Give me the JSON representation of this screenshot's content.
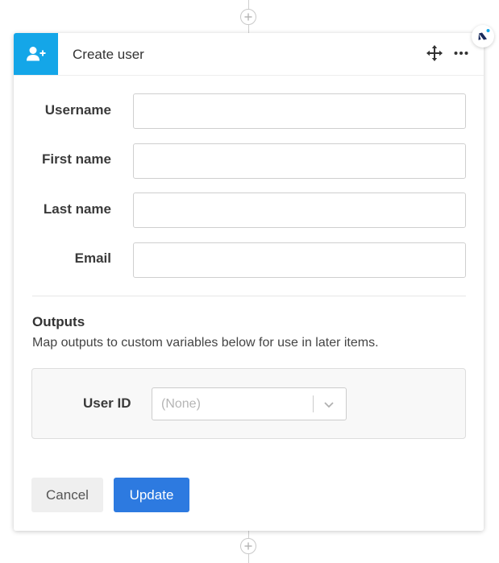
{
  "card": {
    "title": "Create user",
    "header_icon": "add-user-icon",
    "accent_color": "#14a6e8"
  },
  "fields": [
    {
      "label": "Username",
      "value": ""
    },
    {
      "label": "First name",
      "value": ""
    },
    {
      "label": "Last name",
      "value": ""
    },
    {
      "label": "Email",
      "value": ""
    }
  ],
  "outputs": {
    "title": "Outputs",
    "description": "Map outputs to custom variables below for use in later items.",
    "items": [
      {
        "label": "User ID",
        "selected": "(None)"
      }
    ]
  },
  "buttons": {
    "cancel_label": "Cancel",
    "update_label": "Update",
    "update_color": "#2d7ae0"
  },
  "icons": {
    "add_step": "plus-circle-icon",
    "move": "move-arrows-icon",
    "more": "ellipsis-icon",
    "dropdown": "chevron-down-icon",
    "brand": "brand-logo-icon"
  }
}
